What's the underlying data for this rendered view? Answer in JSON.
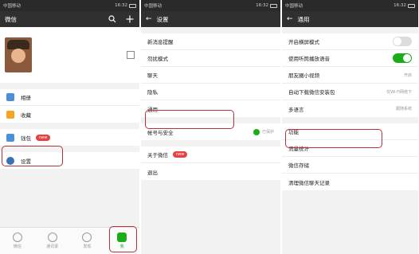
{
  "statusbar": {
    "carrier": "中国移动",
    "time": "16:32"
  },
  "screen1": {
    "title": "微信",
    "items": [
      {
        "label": "相册",
        "color": "#4a90d9"
      },
      {
        "label": "收藏",
        "color": "#f5a623"
      },
      {
        "label": "钱包",
        "color": "#4a90d9",
        "badge": "new"
      },
      {
        "label": "设置",
        "color": "#3b6fb6"
      }
    ],
    "tabs": [
      "微信",
      "通讯录",
      "发现",
      "我"
    ]
  },
  "screen2": {
    "title": "设置",
    "items": [
      "新消息提醒",
      "勿扰模式",
      "聊天",
      "隐私",
      "通用",
      "帐号与安全",
      "关于微信",
      "退出"
    ],
    "security_status": "已保护",
    "about_badge": "new"
  },
  "screen3": {
    "title": "通用",
    "items": [
      "开启横屏模式",
      "使用听筒播放语音",
      "朋友圈小视频",
      "自动下载微信安装包",
      "多语言",
      "功能",
      "流量统计",
      "微信存储",
      "清理微信聊天记录"
    ],
    "video_hint": "开启",
    "download_hint": "仅Wi-Fi网络下",
    "language_hint": "跟随系统"
  }
}
